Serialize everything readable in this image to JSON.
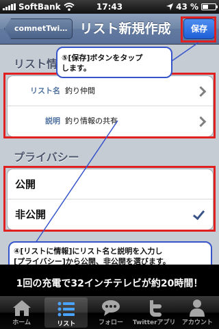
{
  "status_bar": {
    "carrier": "SoftBank",
    "time": "17:43",
    "battery": "43 %",
    "battery_level": 0.43
  },
  "nav": {
    "back_label": "comnetTwiL...",
    "title": "リスト新規作成",
    "save_label": "保存"
  },
  "list_info": {
    "header": "リスト情",
    "fields": [
      {
        "label": "リスト名",
        "value": "釣り仲間"
      },
      {
        "label": "説明",
        "value": "釣り情報の共有"
      }
    ]
  },
  "privacy": {
    "header": "プライバシー",
    "options": [
      {
        "label": "公開",
        "selected": false
      },
      {
        "label": "非公開",
        "selected": true
      }
    ]
  },
  "callouts": {
    "step5_line1": "⑤[保存]ボタンをタップ",
    "step5_line2": "します。",
    "step4_line1": "④[リストに情報]にリスト名と説明を入力し",
    "step4_line2": "[プライバシー]から公開、非公開を選びます。"
  },
  "ad_text": "1回の充電で32インチテレビが約20時間！",
  "tabbar": [
    {
      "label": "ホーム",
      "icon": "home-icon"
    },
    {
      "label": "リスト",
      "icon": "list-icon",
      "active": true
    },
    {
      "label": "フォロー",
      "icon": "speech-bubble-icon"
    },
    {
      "label": "Twitterアプリ",
      "icon": "twitter-t-icon"
    },
    {
      "label": "アカウント",
      "icon": "person-icon"
    }
  ],
  "colors": {
    "annotation_red": "#e02020",
    "callout_border": "#3654c9",
    "nav_blue": "#6f86a7",
    "save_blue": "#1f5fd8"
  }
}
